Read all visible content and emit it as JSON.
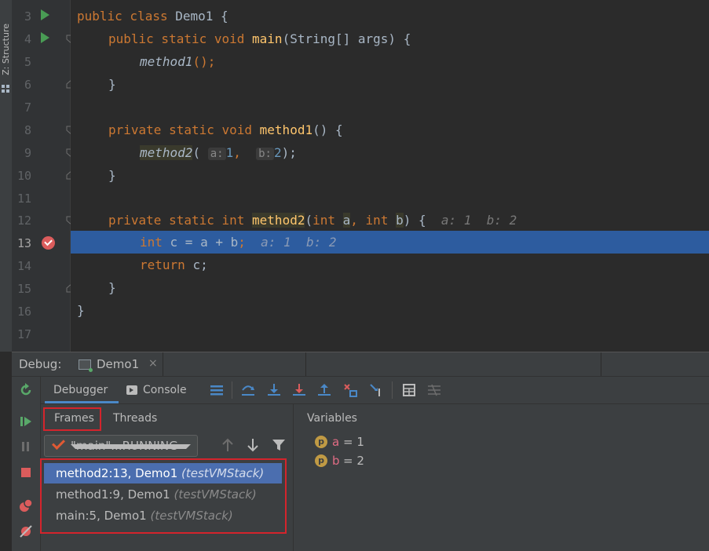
{
  "strip": {
    "label": "Z: Structure"
  },
  "editor": {
    "lines": [
      {
        "num": "3"
      },
      {
        "num": "4"
      },
      {
        "num": "5"
      },
      {
        "num": "6"
      },
      {
        "num": "7"
      },
      {
        "num": "8"
      },
      {
        "num": "9"
      },
      {
        "num": "10"
      },
      {
        "num": "11"
      },
      {
        "num": "12"
      },
      {
        "num": "13"
      },
      {
        "num": "14"
      },
      {
        "num": "15"
      },
      {
        "num": "16"
      },
      {
        "num": "17"
      }
    ],
    "code": {
      "l3": {
        "kw": "public class ",
        "name": "Demo1 {"
      },
      "l4": {
        "kw": "public static void ",
        "fn": "main",
        "rest": "(String[] args) {"
      },
      "l5": {
        "fn": "method1",
        "rest": "();"
      },
      "l6": {
        "text": "}"
      },
      "l8": {
        "kw": "private static void ",
        "fn": "method1",
        "rest": "() {"
      },
      "l9": {
        "fn": "method2",
        "open": "(",
        "hint_a": "a:",
        "val_a": "1",
        "comma": ",",
        "hint_b": "b:",
        "val_b": "2",
        "close": ");"
      },
      "l10": {
        "text": "}"
      },
      "l12": {
        "kw": "private static int ",
        "fn": "method2",
        "open": "(",
        "kw_int1": "int ",
        "pa": "a",
        "comma": ", ",
        "kw_int2": "int ",
        "pb": "b",
        "close": ") {",
        "inline": "a: 1  b: 2"
      },
      "l13": {
        "kw": "int ",
        "expr": "c = a + b",
        "semi": ";",
        "inline": "a: 1  b: 2"
      },
      "l14": {
        "kw": "return ",
        "rest": "c;"
      },
      "l15": {
        "text": "}"
      },
      "l16": {
        "text": "}"
      }
    }
  },
  "debug": {
    "label": "Debug:",
    "tab": "Demo1",
    "tab_close": "×",
    "tabs": {
      "debugger": "Debugger",
      "console": "Console"
    },
    "frames_tab": "Frames",
    "threads_tab": "Threads",
    "variables_title": "Variables",
    "thread_select": "\"main\"...RUNNING",
    "frames": [
      {
        "method": "method2:13, Demo1 ",
        "loc": "(testVMStack)"
      },
      {
        "method": "method1:9, Demo1 ",
        "loc": "(testVMStack)"
      },
      {
        "method": "main:5, Demo1 ",
        "loc": "(testVMStack)"
      }
    ],
    "variables": [
      {
        "icon": "p",
        "name": "a",
        "value": " = 1"
      },
      {
        "icon": "p",
        "name": "b",
        "value": " = 2"
      }
    ]
  },
  "colors": {
    "accent": "#4a88c7",
    "selection": "#4b6eaf",
    "current_line": "#2d5c9f",
    "highlight_box": "#d4242c"
  }
}
